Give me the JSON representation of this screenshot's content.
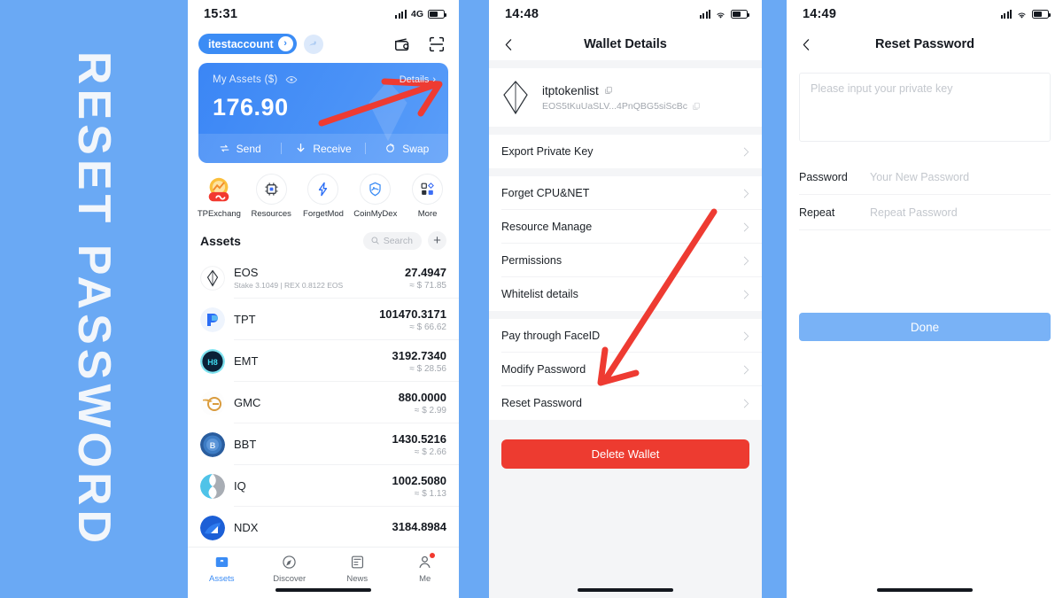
{
  "banner": {
    "text": "RESET PASSWORD",
    "bg_color": "#6aa9f4",
    "text_color": "#f2f6fb"
  },
  "theme": {
    "accent": "#3b8cf5",
    "danger": "#ed3b30",
    "done_button": "#79b2f6",
    "page_bg": "#f4f5f7"
  },
  "screen1": {
    "status": {
      "time": "15:31",
      "network": "4G"
    },
    "account": {
      "name": "itestaccount",
      "chevron": "chevron-right-icon"
    },
    "header_icons": [
      "wallet-camera-icon",
      "scan-qr-icon"
    ],
    "card": {
      "label": "My Assets ($)",
      "eye_icon": "eye-icon",
      "details_label": "Details",
      "amount": "176.90",
      "actions": [
        {
          "label": "Send",
          "icon": "send-swap-icon"
        },
        {
          "label": "Receive",
          "icon": "arrow-down-icon"
        },
        {
          "label": "Swap",
          "icon": "swap-circle-icon"
        }
      ]
    },
    "quick_actions": [
      {
        "label": "TPExchang",
        "icon": "tpexchange-icon"
      },
      {
        "label": "Resources",
        "icon": "cpu-chip-icon"
      },
      {
        "label": "ForgetMod",
        "icon": "lightning-bolt-icon"
      },
      {
        "label": "CoinMyDex",
        "icon": "shield-icon"
      },
      {
        "label": "More",
        "icon": "grid-more-icon"
      }
    ],
    "assets_header": {
      "title": "Assets",
      "search_placeholder": "Search",
      "search_icon": "search-icon",
      "add_label": "+"
    },
    "assets": [
      {
        "symbol": "EOS",
        "sub": "Stake 3.1049  |  REX 0.8122 EOS",
        "amount": "27.4947",
        "usd": "≈ $ 71.85",
        "icon": "eos-token-icon"
      },
      {
        "symbol": "TPT",
        "sub": "",
        "amount": "101470.3171",
        "usd": "≈ $ 66.62",
        "icon": "tpt-token-icon"
      },
      {
        "symbol": "EMT",
        "sub": "",
        "amount": "3192.7340",
        "usd": "≈ $ 28.56",
        "icon": "emt-token-icon"
      },
      {
        "symbol": "GMC",
        "sub": "",
        "amount": "880.0000",
        "usd": "≈ $ 2.99",
        "icon": "gmc-token-icon"
      },
      {
        "symbol": "BBT",
        "sub": "",
        "amount": "1430.5216",
        "usd": "≈ $ 2.66",
        "icon": "bbt-token-icon"
      },
      {
        "symbol": "IQ",
        "sub": "",
        "amount": "1002.5080",
        "usd": "≈ $ 1.13",
        "icon": "iq-token-icon"
      },
      {
        "symbol": "NDX",
        "sub": "",
        "amount": "3184.8984",
        "usd": "",
        "icon": "ndx-token-icon"
      }
    ],
    "tabs": [
      {
        "label": "Assets",
        "icon": "wallet-icon",
        "active": true,
        "badge": false
      },
      {
        "label": "Discover",
        "icon": "compass-icon",
        "active": false,
        "badge": false
      },
      {
        "label": "News",
        "icon": "news-icon",
        "active": false,
        "badge": false
      },
      {
        "label": "Me",
        "icon": "person-icon",
        "active": false,
        "badge": true
      }
    ]
  },
  "screen2": {
    "status": {
      "time": "14:48"
    },
    "nav": {
      "title": "Wallet Details",
      "back_icon": "chevron-left-icon"
    },
    "wallet": {
      "name": "itptokenlist",
      "name_copy_icon": "copy-icon",
      "public_key": "EOS5tKuUaSLV...4PnQBG5siScBc",
      "key_copy_icon": "copy-icon",
      "logo": "eos-logo-icon"
    },
    "group1": [
      {
        "label": "Export Private Key"
      }
    ],
    "group2": [
      {
        "label": "Forget CPU&NET"
      },
      {
        "label": "Resource Manage"
      },
      {
        "label": "Permissions"
      },
      {
        "label": "Whitelist details"
      }
    ],
    "group3": [
      {
        "label": "Pay through FaceID"
      },
      {
        "label": "Modify Password"
      },
      {
        "label": "Reset Password"
      }
    ],
    "delete_label": "Delete Wallet"
  },
  "screen3": {
    "status": {
      "time": "14:49"
    },
    "nav": {
      "title": "Reset Password",
      "back_icon": "chevron-left-icon"
    },
    "private_key_placeholder": "Please input your private key",
    "fields": [
      {
        "label": "Password",
        "placeholder": "Your New Password",
        "value": ""
      },
      {
        "label": "Repeat",
        "placeholder": "Repeat Password",
        "value": ""
      }
    ],
    "done_label": "Done"
  },
  "annotations": [
    {
      "name": "arrow-to-details",
      "color": "#ee3b32"
    },
    {
      "name": "arrow-to-reset-password",
      "color": "#ee3b32"
    }
  ]
}
